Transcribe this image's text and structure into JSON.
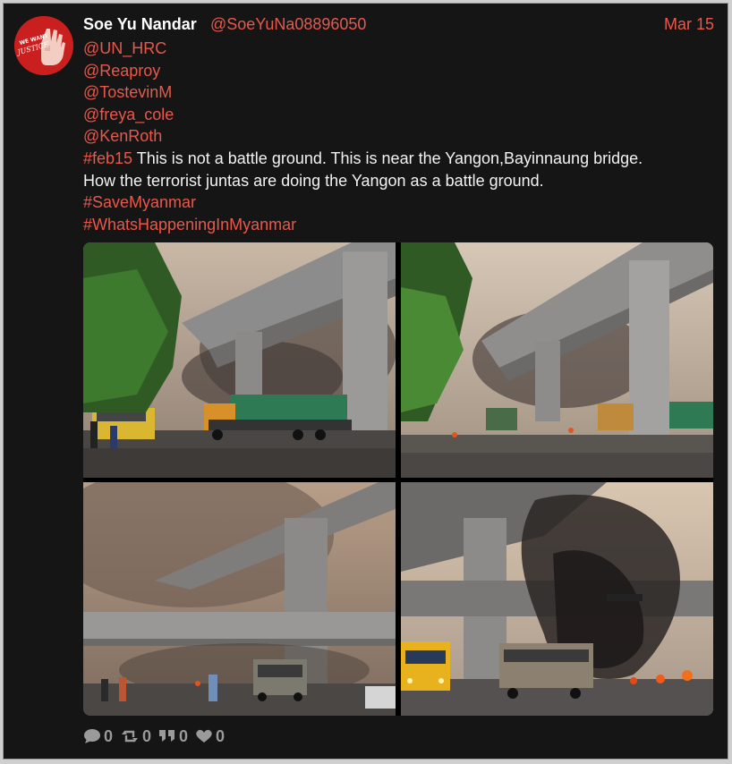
{
  "tweet": {
    "author_name": "Soe Yu Nandar",
    "author_handle": "@SoeYuNa08896050",
    "date": "Mar 15",
    "avatar_text": "JUSTICE",
    "mentions": [
      "@UN_HRC",
      "@Reaproy",
      "@TostevinM",
      "@freya_cole",
      "@KenRoth"
    ],
    "text_hashtag": "#feb15",
    "text_line1": " This is not a battle ground. This is near the Yangon,Bayinnaung bridge.",
    "text_line2": "How the terrorist juntas are doing the Yangon as a battle ground.",
    "hashtags": [
      "#SaveMyanmar",
      "#WhatsHappeningInMyanmar"
    ]
  },
  "actions": {
    "reply_count": "0",
    "retweet_count": "0",
    "quote_count": "0",
    "like_count": "0"
  },
  "colors": {
    "background": "#151515",
    "link": "#e8584c",
    "text": "#f2f2f2",
    "muted": "#9a9a9a",
    "avatar": "#c9201f"
  },
  "icons": [
    "reply-icon",
    "retweet-icon",
    "quote-icon",
    "like-icon"
  ]
}
